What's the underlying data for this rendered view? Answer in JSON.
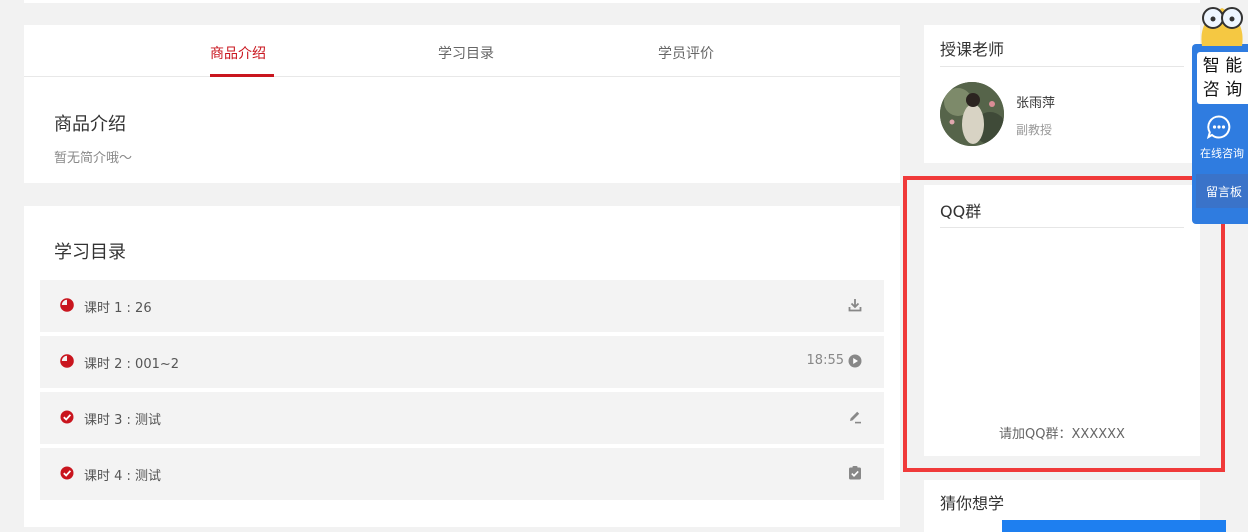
{
  "tabs": [
    {
      "label": "商品介绍",
      "active": true
    },
    {
      "label": "学习目录",
      "active": false
    },
    {
      "label": "学员评价",
      "active": false
    }
  ],
  "intro": {
    "title": "商品介绍",
    "text": "暂无简介哦～"
  },
  "catalog": {
    "title": "学习目录",
    "lessons": [
      {
        "label": "课时 1 : 26",
        "status": "in-progress",
        "duration": "",
        "action_icon": "download-icon"
      },
      {
        "label": "课时 2 : 001~2",
        "status": "in-progress",
        "duration": "18:55",
        "action_icon": "play-icon"
      },
      {
        "label": "课时 3 : 测试",
        "status": "done",
        "duration": "",
        "action_icon": "edit-icon"
      },
      {
        "label": "课时 4 : 测试",
        "status": "done",
        "duration": "",
        "action_icon": "checklist-icon"
      }
    ]
  },
  "teacher": {
    "section_title": "授课老师",
    "name": "张雨萍",
    "role": "副教授"
  },
  "qq": {
    "section_title": "QQ群",
    "text": "请加QQ群：XXXXXX"
  },
  "guess": {
    "section_title": "猜你想学"
  },
  "float_consult": {
    "smart_line1": "智 能",
    "smart_line2": "咨 询",
    "online": "在线咨询",
    "board": "留言板"
  },
  "colors": {
    "accent": "#c9151e",
    "consult_blue": "#2f7ce0",
    "highlight": "#f03a3a"
  }
}
